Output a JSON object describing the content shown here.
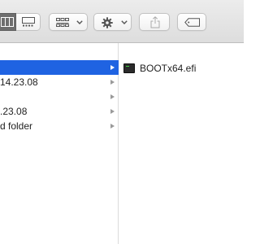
{
  "toolbar": {
    "view_buttons": [
      {
        "name": "column-view-button",
        "icon": "column-view-icon",
        "selected": true
      },
      {
        "name": "gallery-view-button",
        "icon": "gallery-view-icon",
        "selected": false
      }
    ],
    "group_button": {
      "icon": "group-grid-icon",
      "dropdown_icon": "chevron-down-icon"
    },
    "action_button": {
      "icon": "gear-icon",
      "dropdown_icon": "chevron-down-icon"
    },
    "share_button": {
      "icon": "share-icon"
    },
    "tag_button": {
      "icon": "tag-icon"
    }
  },
  "column1": {
    "rows": [
      {
        "label": "",
        "selected": true,
        "has_chevron": true
      },
      {
        "label": "14.23.08",
        "selected": false,
        "has_chevron": true
      },
      {
        "label": "",
        "selected": false,
        "has_chevron": true
      },
      {
        "label": ".23.08",
        "selected": false,
        "has_chevron": true
      },
      {
        "label": "d folder",
        "selected": false,
        "has_chevron": true
      }
    ]
  },
  "column2": {
    "items": [
      {
        "name": "BOOTx64.efi",
        "icon": "executable-file-icon"
      }
    ]
  },
  "colors": {
    "selection": "#1f63e2",
    "toolbar_bg": "#e4e4e4",
    "active_segment": "#6e6e6e"
  }
}
